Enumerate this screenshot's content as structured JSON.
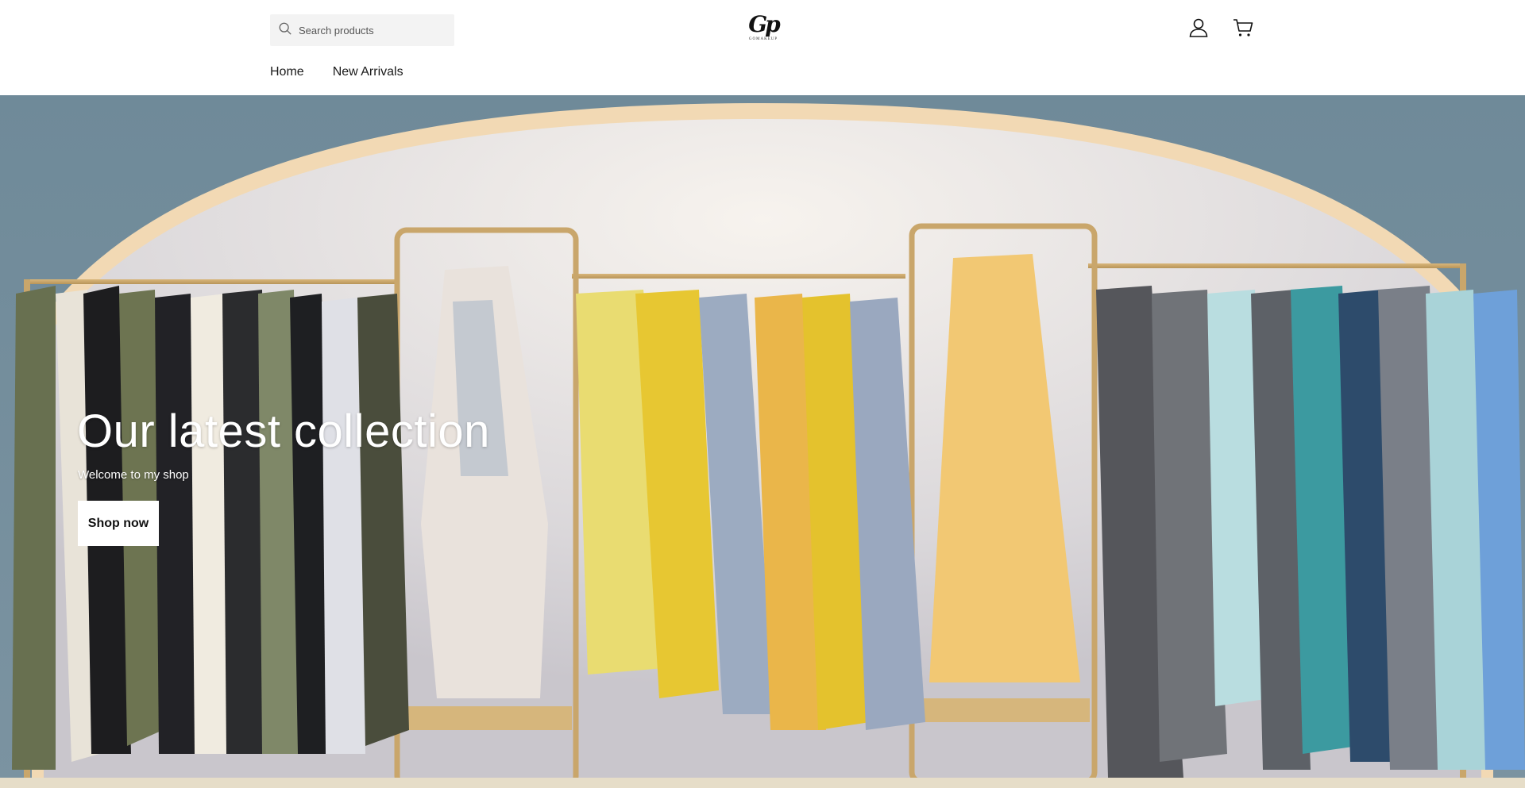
{
  "header": {
    "search": {
      "placeholder": "Search products",
      "icon": "search-icon"
    },
    "logo": {
      "monogram": "Gp",
      "subtitle": "GOMAKEUP"
    },
    "account_icon": "user-icon",
    "cart_icon": "cart-icon"
  },
  "nav": {
    "items": [
      {
        "label": "Home"
      },
      {
        "label": "New Arrivals"
      }
    ]
  },
  "hero": {
    "title": "Our latest collection",
    "subtitle": "Welcome to my shop",
    "button_label": "Shop now"
  }
}
